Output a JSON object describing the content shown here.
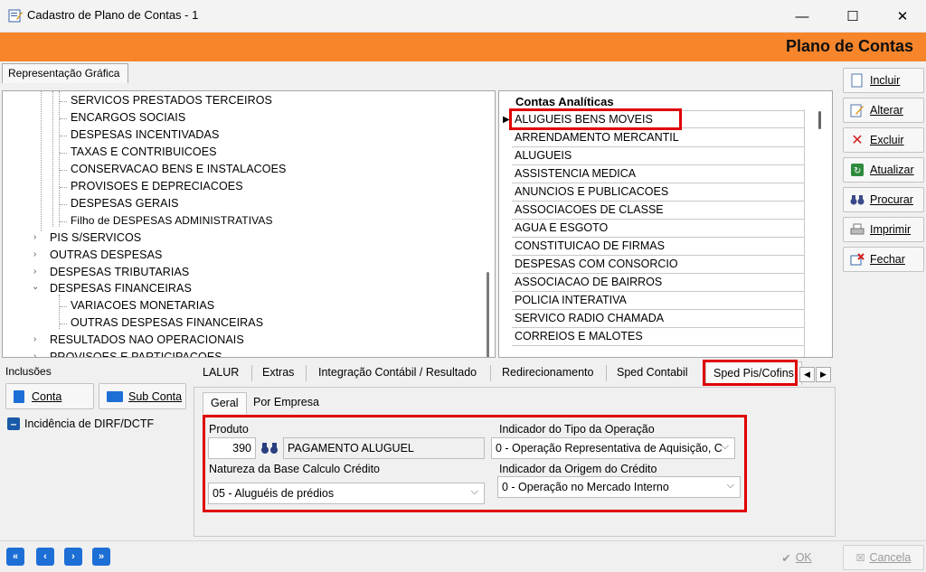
{
  "window": {
    "title": "Cadastro de Plano de Contas - 1",
    "minimize": "—",
    "maximize": "☐",
    "close": "✕"
  },
  "header": {
    "title": "Plano de Contas"
  },
  "tree": {
    "tab_label": "Representação Gráfica",
    "children_top": [
      "SERVICOS PRESTADOS TERCEIROS",
      "ENCARGOS SOCIAIS",
      "DESPESAS INCENTIVADAS",
      "TAXAS E CONTRIBUICOES",
      "CONSERVACAO BENS E INSTALACOES",
      "PROVISOES E DEPRECIACOES",
      "DESPESAS GERAIS",
      "Filho de DESPESAS ADMINISTRATIVAS"
    ],
    "groups": [
      "PIS S/SERVICOS",
      "OUTRAS DESPESAS",
      "DESPESAS TRIBUTARIAS",
      "DESPESAS FINANCEIRAS"
    ],
    "children_fin": [
      "VARIACOES MONETARIAS",
      "OUTRAS DESPESAS FINANCEIRAS"
    ],
    "after": [
      "RESULTADOS NAO OPERACIONAIS",
      "PROVISOES E PARTICIPACOES"
    ]
  },
  "grid": {
    "header": "Contas Analíticas",
    "rows": [
      "ALUGUEIS BENS MOVEIS",
      "ARRENDAMENTO MERCANTIL",
      "ALUGUEIS",
      "ASSISTENCIA MEDICA",
      "ANUNCIOS E PUBLICACOES",
      "ASSOCIACOES DE CLASSE",
      "AGUA E ESGOTO",
      "CONSTITUICAO DE FIRMAS",
      "DESPESAS COM CONSORCIO",
      "ASSOCIACAO DE BAIRROS",
      "POLICIA INTERATIVA",
      "SERVICO RADIO CHAMADA",
      "CORREIOS E MALOTES"
    ]
  },
  "actions": {
    "incluir": "Incluir",
    "alterar": "Alterar",
    "excluir": "Excluir",
    "atualizar": "Atualizar",
    "procurar": "Procurar",
    "imprimir": "Imprimir",
    "fechar": "Fechar"
  },
  "inclusoes": {
    "title": "Inclusões",
    "conta": "Conta",
    "sub_conta": "Sub Conta",
    "dirf": "Incidência de DIRF/DCTF"
  },
  "tabs": [
    "LALUR",
    "Extras",
    "Integração Contábil / Resultado",
    "Redirecionamento",
    "Sped Contabil",
    "Sped Pis/Cofins"
  ],
  "subtabs": [
    "Geral",
    "Por Empresa"
  ],
  "form": {
    "produto_label": "Produto",
    "produto_code": "390",
    "produto_name": "PAGAMENTO ALUGUEL",
    "natureza_label": "Natureza da Base Calculo Crédito",
    "natureza_value": "05 - Aluguéis de prédios",
    "tipo_op_label": "Indicador do Tipo da Operação",
    "tipo_op_value": "0 - Operação Representativa de Aquisição, C",
    "origem_label": "Indicador da Origem do Crédito",
    "origem_value": "0 - Operação no Mercado Interno"
  },
  "footer": {
    "ok": "OK",
    "cancela": "Cancela"
  },
  "colors": {
    "header": "#f7852b",
    "highlight": "#e00000",
    "nav": "#1d6fd6"
  }
}
